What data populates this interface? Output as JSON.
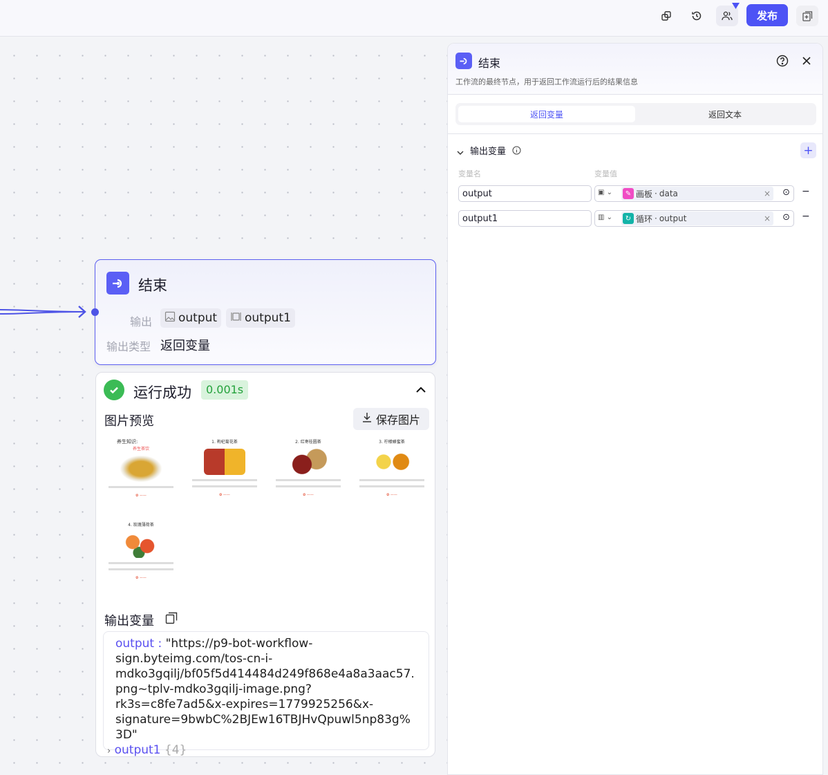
{
  "topbar": {
    "publish_label": "发布",
    "icons": [
      "copy-icon",
      "history-icon",
      "collaborators-icon",
      "add-panel-icon"
    ]
  },
  "node": {
    "title": "结束",
    "output_label": "输出",
    "outputs": [
      "output",
      "output1"
    ],
    "output_type_label": "输出类型",
    "output_type_value": "返回变量"
  },
  "result": {
    "status": "运行成功",
    "time": "0.001s",
    "image_preview_label": "图片预览",
    "save_image_label": "保存图片",
    "thumbnails": [
      {
        "title": "养生知识:",
        "sub": "养生茶饮"
      },
      {
        "title": "1. 枸杞菊花茶"
      },
      {
        "title": "2. 红枣桂圆茶"
      },
      {
        "title": "3. 柠檬蜂蜜茶"
      },
      {
        "title": "4. 玫瑰薄荷茶"
      }
    ],
    "output_vars_label": "输出变量",
    "output_key": "output :",
    "output_value": "\"https://p9-bot-workflow-sign.byteimg.com/tos-cn-i-mdko3gqilj/bf05f5d414484d249f868e4a8a3aac57.png~tplv-mdko3gqilj-image.png?rk3s=c8fe7ad5&x-expires=1779925256&x-signature=9bwbC%2BJEw16TBJHvQpuwl5np83g%3D\"",
    "output1_key": "output1",
    "output1_count": "{4}"
  },
  "panel": {
    "title": "结束",
    "description": "工作流的最终节点，用于返回工作流运行后的结果信息",
    "tabs": [
      "返回变量",
      "返回文本"
    ],
    "section": "输出变量",
    "col_name": "变量名",
    "col_value": "变量值",
    "rows": [
      {
        "name": "output",
        "source": "画板",
        "field": "data"
      },
      {
        "name": "output1",
        "source": "循环",
        "field": "output"
      }
    ]
  },
  "colors": {
    "accent": "#4d53f5",
    "success": "#3bbb55"
  }
}
